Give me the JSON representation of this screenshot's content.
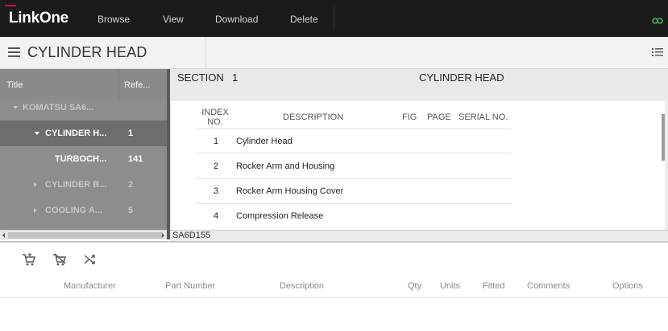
{
  "app": {
    "logo": "LinkOne",
    "nav": [
      "Browse",
      "View",
      "Download",
      "Delete"
    ]
  },
  "titlebar": {
    "title": "CYLINDER HEAD"
  },
  "tree": {
    "headers": {
      "title": "Title",
      "ref": "Refe..."
    },
    "rows": [
      {
        "label": "KOMATSU SA6...",
        "ref": "",
        "state": "expanded"
      },
      {
        "label": "CYLINDER H...",
        "ref": "1",
        "state": "expanded"
      },
      {
        "label": "TURBOCH...",
        "ref": "141",
        "state": "leaf"
      },
      {
        "label": "CYLINDER B...",
        "ref": "2",
        "state": "collapsed"
      },
      {
        "label": "COOLING A...",
        "ref": "5",
        "state": "collapsed"
      }
    ]
  },
  "section": {
    "label": "SECTION",
    "number": "1",
    "title": "CYLINDER HEAD"
  },
  "parts_table": {
    "headers": {
      "index_line1": "INDEX",
      "index_line2": "NO.",
      "description": "DESCRIPTION",
      "fig": "FIG",
      "page": "PAGE",
      "serial": "SERIAL NO."
    },
    "rows": [
      {
        "index": "1",
        "description": "Cylinder Head"
      },
      {
        "index": "2",
        "description": "Rocker Arm and Housing"
      },
      {
        "index": "3",
        "description": "Rocker Arm Housing Cover"
      },
      {
        "index": "4",
        "description": "Compression Release"
      }
    ]
  },
  "footer": {
    "code": "SA6D155"
  },
  "parts_list": {
    "headers": [
      "Manufacturer",
      "Part Number",
      "Description",
      "Qty",
      "Units",
      "Fitted",
      "Comments",
      "Options"
    ]
  },
  "colors": {
    "topbar": "#1b1b1b",
    "logo_accent": "#c8102e",
    "link_icon": "#4caf50",
    "tree_bg": "#8d8d8d",
    "tree_selected": "#6d6d6d"
  },
  "icons": {
    "menu": "hamburger-icon",
    "list_view": "list-icon",
    "link": "link-icon",
    "add_to_cart": "cart-add-icon",
    "remove_from_cart": "cart-remove-icon",
    "shuffle": "shuffle-icon"
  }
}
